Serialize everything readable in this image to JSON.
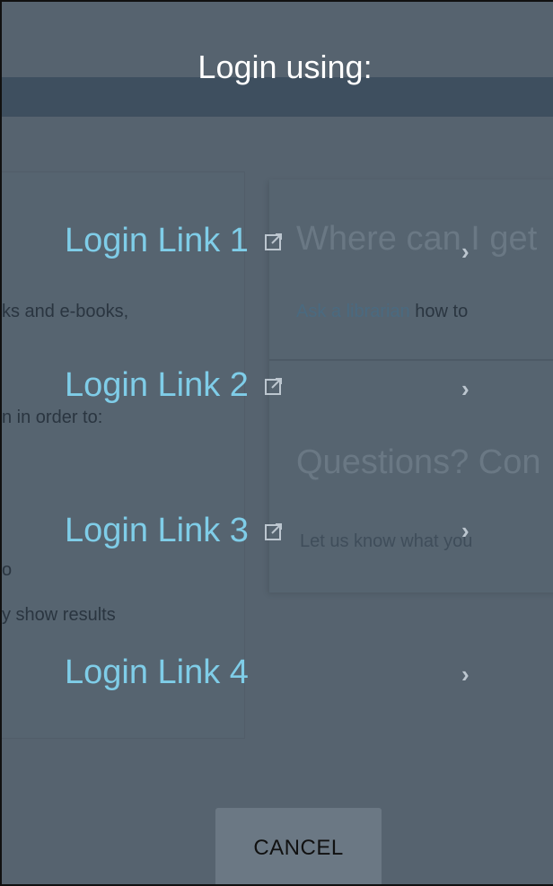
{
  "overlay": {
    "title": "Login using:",
    "links": [
      {
        "label": "Login Link 1",
        "external": true
      },
      {
        "label": "Login Link 2",
        "external": true
      },
      {
        "label": "Login Link 3",
        "external": true
      },
      {
        "label": "Login Link 4",
        "external": false
      }
    ],
    "cancel_label": "CANCEL"
  },
  "background": {
    "left_lines": [
      "ks and e-books,",
      "n in order to:",
      "o",
      "y show results"
    ],
    "right_heading_1": "Where can I get",
    "right_text_1_link": "Ask a librarian",
    "right_text_1_rest": " how to",
    "right_heading_2": "Questions? Con",
    "right_text_2": "Let us know what you"
  },
  "colors": {
    "overlay_bg": "#56636f",
    "link": "#7fcde8",
    "title": "#ffffff",
    "cancel_bg": "#6b7884"
  },
  "icons": {
    "external": "external-link-icon",
    "chevron": "chevron-right-icon"
  }
}
